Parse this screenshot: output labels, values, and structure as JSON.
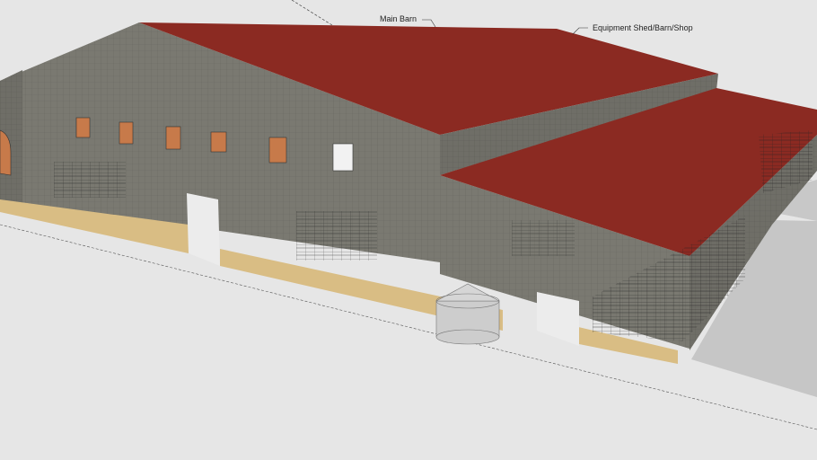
{
  "viewport": {
    "labels": [
      {
        "id": "main-barn",
        "text": "Main Barn"
      },
      {
        "id": "equipment-shed",
        "text": "Equipment Shed/Barn/Shop"
      }
    ]
  },
  "colors": {
    "background": "#e6e6e6",
    "roof": "#8b2a22",
    "wall": "#77766e",
    "foundation": "#d9bd84",
    "silo": "#cdcdcd",
    "side_panel": "#c7c7c7"
  },
  "objects": [
    "main-barn",
    "equipment-shed",
    "grain-silo",
    "fence-panels",
    "windows",
    "doors"
  ]
}
